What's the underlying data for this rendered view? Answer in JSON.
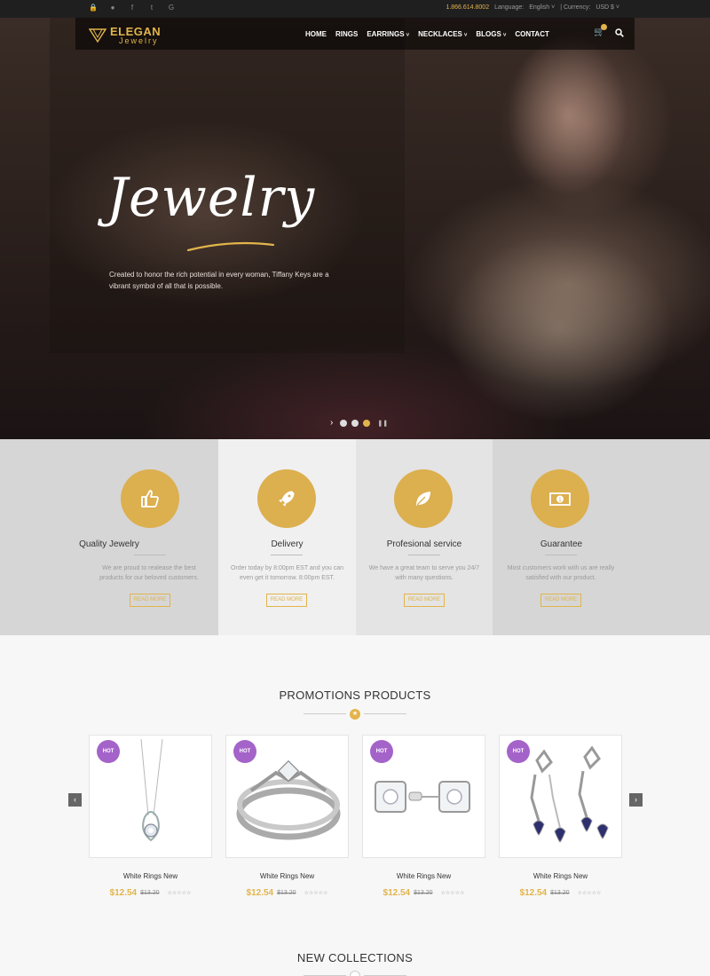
{
  "topbar": {
    "social_icons": [
      "lock-icon",
      "user-icon",
      "facebook-icon",
      "twitter-icon",
      "google-icon"
    ],
    "phone": "1.866.614.8002",
    "language_label": "Language:",
    "language_value": "English",
    "currency_label": "| Currency:",
    "currency_value": "USD $"
  },
  "header": {
    "brand": "ELEGAN",
    "brand_sub": "Jewelry",
    "nav": [
      {
        "label": "HOME"
      },
      {
        "label": "RINGS"
      },
      {
        "label": "EARRINGS"
      },
      {
        "label": "NECKLACES"
      },
      {
        "label": "BLOGS"
      },
      {
        "label": "CONTACT"
      }
    ]
  },
  "hero": {
    "title": "Jewelry",
    "description": "Created to honor the rich potential in every woman, Tiffany Keys are a vibrant symbol of all that is possible.",
    "slides_total": 3,
    "active_slide": 3
  },
  "features": [
    {
      "title": "Quality Jewelry",
      "desc_line1": "We are proud to realease the best",
      "desc_line2": "products for our beloved customers.",
      "button": "READ MORE",
      "icon": "thumbs-up-icon"
    },
    {
      "title": "Delivery",
      "desc_line1": "Order today by 8:00pm EST and you can",
      "desc_line2": "even get it tomorrow. 8:00pm EST.",
      "button": "READ MORE",
      "icon": "rocket-icon"
    },
    {
      "title": "Profesional service",
      "desc_line1": "We have a great team to serve you 24/7",
      "desc_line2": "with many questions.",
      "button": "READ MORE",
      "icon": "leaf-icon"
    },
    {
      "title": "Guarantee",
      "desc_line1": "Most customers work with us are really",
      "desc_line2": "satisfied with our product.",
      "button": "READ MORE",
      "icon": "money-icon"
    }
  ],
  "promotions": {
    "title": "PROMOTIONS PRODUCTS",
    "products": [
      {
        "badge": "HOT",
        "name": "White Rings New",
        "price": "$12.54",
        "old_price": "$13.20",
        "rating": "☆☆☆☆☆",
        "image": "necklace"
      },
      {
        "badge": "HOT",
        "name": "White Rings New",
        "price": "$12.54",
        "old_price": "$13.20",
        "rating": "☆☆☆☆☆",
        "image": "ring"
      },
      {
        "badge": "HOT",
        "name": "White Rings New",
        "price": "$12.54",
        "old_price": "$13.20",
        "rating": "☆☆☆☆☆",
        "image": "earrings-stud"
      },
      {
        "badge": "HOT",
        "name": "White Rings New",
        "price": "$12.54",
        "old_price": "$13.20",
        "rating": "☆☆☆☆☆",
        "image": "earrings-drop"
      }
    ]
  },
  "new_collections": {
    "title": "NEW COLLECTIONS"
  },
  "colors": {
    "accent": "#e2b44b",
    "hot_badge": "#a463c9",
    "topbar": "#1f1f1f"
  }
}
